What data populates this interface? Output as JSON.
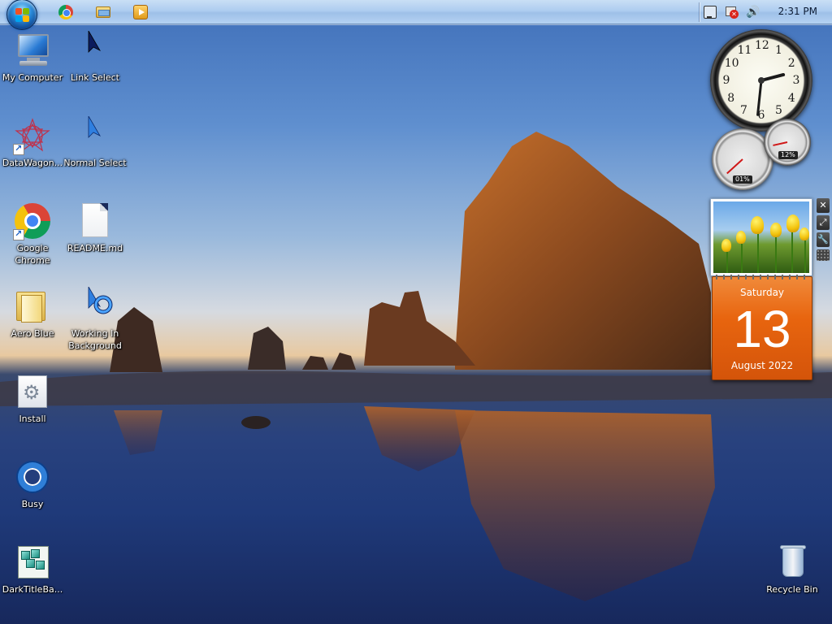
{
  "taskbar": {
    "start_icon": "windows-orb-icon",
    "pinned": [
      {
        "name": "chrome-icon"
      },
      {
        "name": "file-explorer-icon"
      },
      {
        "name": "media-player-icon"
      }
    ],
    "tray_icons": [
      "network-icon",
      "action-center-flag-icon",
      "volume-icon"
    ],
    "clock": "2:31 PM"
  },
  "desktop": {
    "icons": [
      {
        "label": "My Computer",
        "icon": "my-computer-icon"
      },
      {
        "label": "Link Select",
        "icon": "link-select-cursor-icon"
      },
      {
        "label": "DataWagon...",
        "icon": "datawagon-icon"
      },
      {
        "label": "Normal Select",
        "icon": "normal-select-cursor-icon"
      },
      {
        "label": "Google Chrome",
        "icon": "chrome-icon"
      },
      {
        "label": "README.md",
        "icon": "document-icon"
      },
      {
        "label": "Aero Blue",
        "icon": "folder-icon"
      },
      {
        "label": "Working In Background",
        "icon": "working-cursor-icon"
      },
      {
        "label": "Install",
        "icon": "installer-icon"
      },
      {
        "label": "Busy",
        "icon": "busy-cursor-icon"
      },
      {
        "label": "DarkTitleBa...",
        "icon": "registry-icon"
      },
      {
        "label": "Recycle Bin",
        "icon": "recycle-bin-icon"
      }
    ]
  },
  "gadgets": {
    "clock": {
      "numbers": [
        "12",
        "1",
        "2",
        "3",
        "4",
        "5",
        "6",
        "7",
        "8",
        "9",
        "10",
        "11"
      ],
      "hour": 2,
      "minute": 31
    },
    "cpu_meter": {
      "cpu": "01%",
      "memory": "12%",
      "cpu_value": 0.01,
      "memory_value": 0.12
    },
    "calendar": {
      "weekday": "Saturday",
      "day": "13",
      "month_year": "August 2022"
    },
    "toolbar": {
      "close": "✕",
      "size": "⤢",
      "options": "🔧"
    }
  },
  "colors": {
    "taskbar": "#aecdf0",
    "calendar": "#e8650f",
    "meter_needle": "#d01818"
  }
}
